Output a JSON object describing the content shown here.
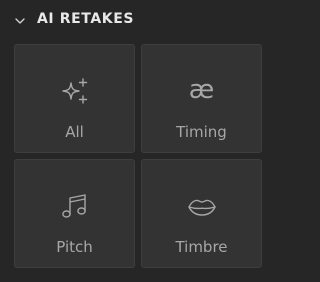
{
  "section": {
    "title": "AI RETAKES",
    "expanded": true
  },
  "tiles": [
    {
      "label": "All",
      "icon": "sparkles-icon"
    },
    {
      "label": "Timing",
      "icon": "ae-ligature-icon",
      "glyph": "æ"
    },
    {
      "label": "Pitch",
      "icon": "music-note-icon"
    },
    {
      "label": "Timbre",
      "icon": "lips-icon"
    }
  ],
  "colors": {
    "background": "#262626",
    "tile": "#333334",
    "tile_border": "#3e3e3f",
    "title": "#e9e9e9",
    "label": "#a7a7a7"
  }
}
